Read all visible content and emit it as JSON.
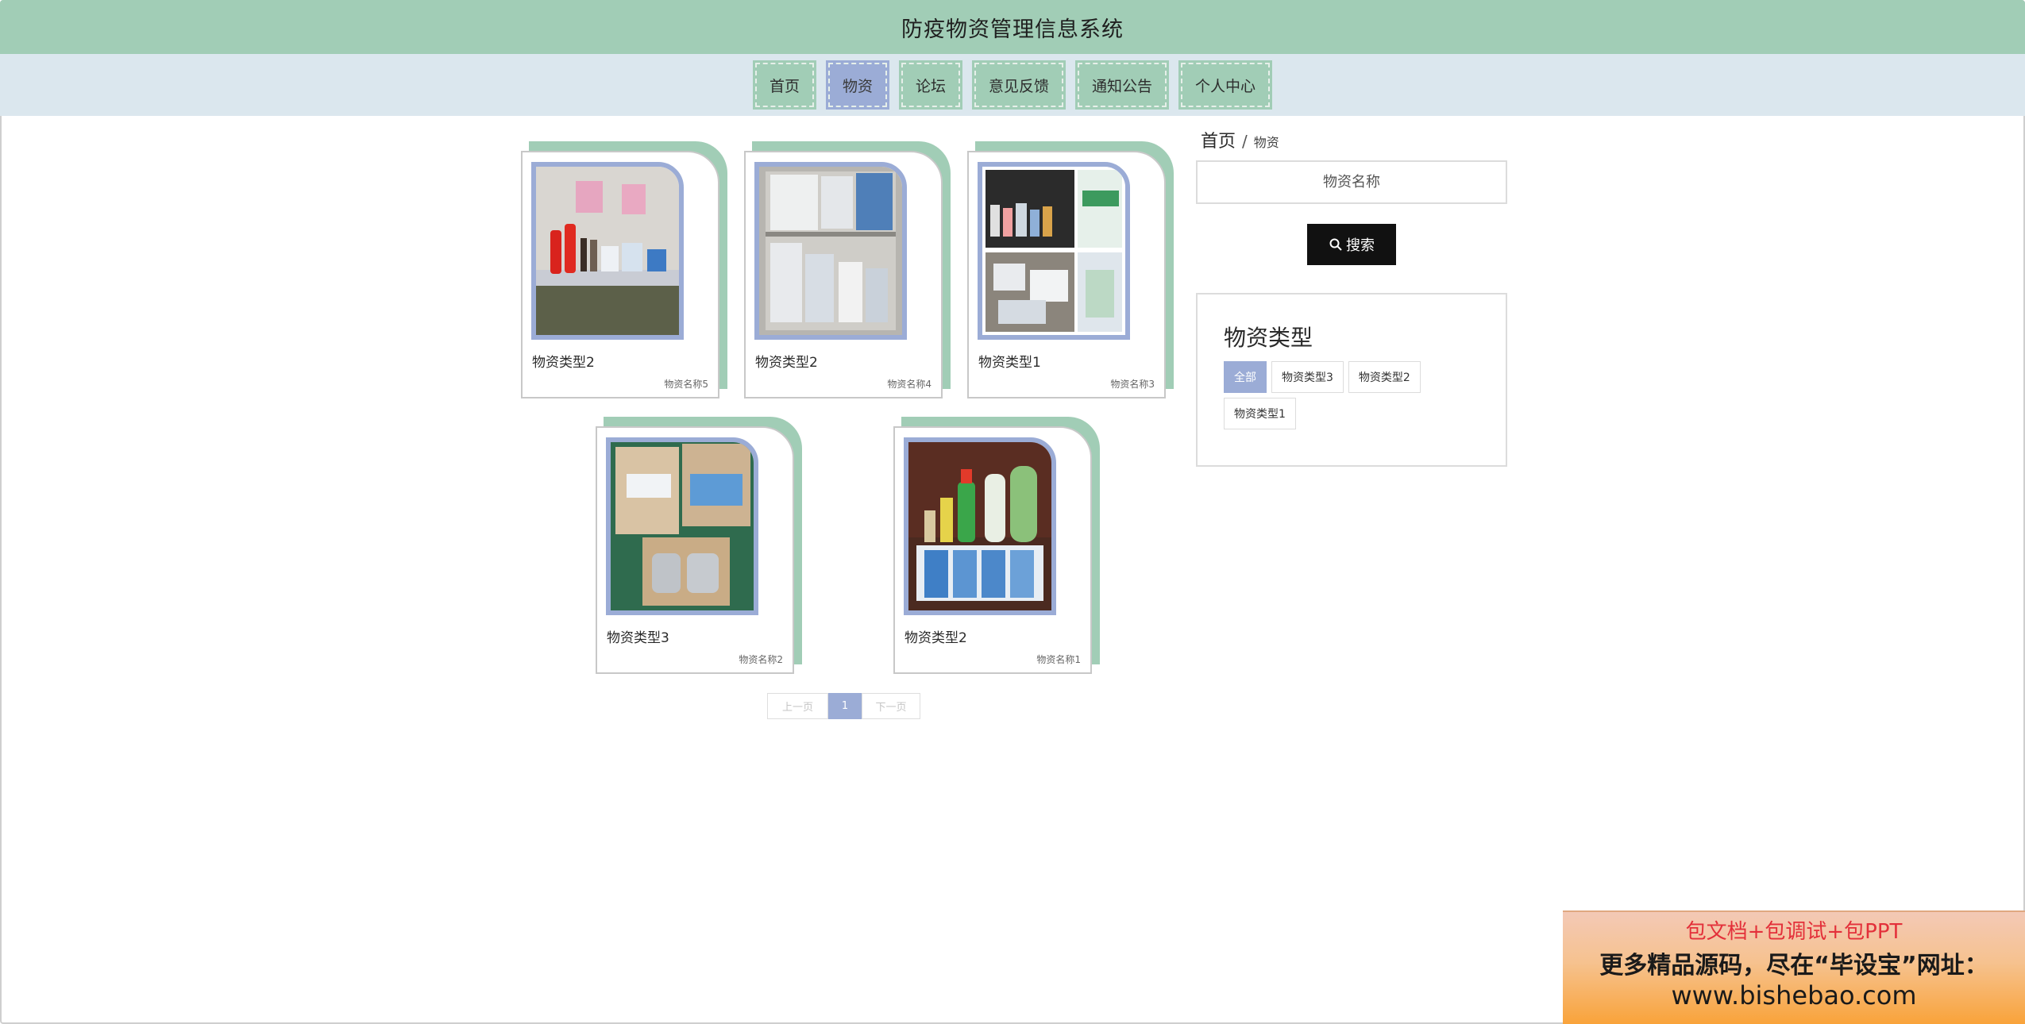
{
  "header": {
    "title": "防疫物资管理信息系统"
  },
  "nav": {
    "items": [
      {
        "label": "首页"
      },
      {
        "label": "物资"
      },
      {
        "label": "论坛"
      },
      {
        "label": "意见反馈"
      },
      {
        "label": "通知公告"
      },
      {
        "label": "个人中心"
      }
    ],
    "active_index": 1
  },
  "cards": [
    {
      "type": "物资类型2",
      "name": "物资名称5"
    },
    {
      "type": "物资类型2",
      "name": "物资名称4"
    },
    {
      "type": "物资类型1",
      "name": "物资名称3"
    },
    {
      "type": "物资类型3",
      "name": "物资名称2"
    },
    {
      "type": "物资类型2",
      "name": "物资名称1"
    }
  ],
  "pagination": {
    "prev": "上一页",
    "current": "1",
    "next": "下一页"
  },
  "breadcrumb": {
    "home": "首页",
    "separator": "/",
    "current": "物资"
  },
  "search": {
    "placeholder": "物资名称",
    "button_label": "搜索"
  },
  "type_filter": {
    "title": "物资类型",
    "tags": [
      "全部",
      "物资类型3",
      "物资类型2",
      "物资类型1"
    ],
    "active_index": 0
  },
  "ad": {
    "line1": "包文档+包调试+包PPT",
    "line2": "更多精品源码，尽在“毕设宝”网址：",
    "line3": "www.bishebao.com"
  },
  "colors": {
    "header_bg": "#a1cdb6",
    "nav_bg": "#dbe7ee",
    "accent": "#9bacd6",
    "search_button": "#111111"
  }
}
